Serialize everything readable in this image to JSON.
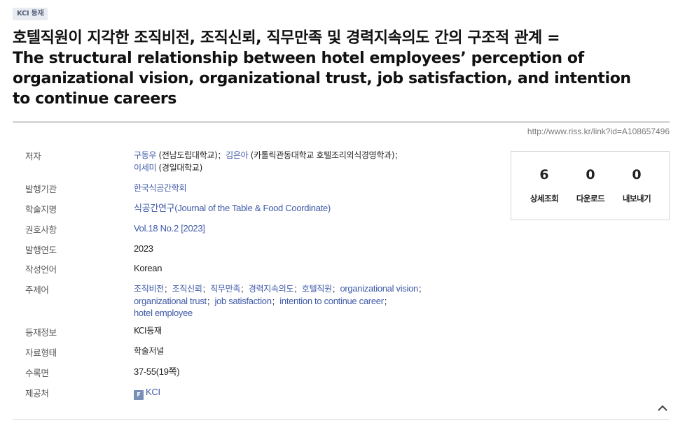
{
  "badge": "KCI 등재",
  "title": {
    "korean": "호텔직원이 지각한 조직비전, 조직신뢰, 직무만족 및 경력지속의도 간의 구조적 관계 =",
    "english": "The structural relationship between hotel employees’ perception of organizational vision, organizational trust, job satisfaction, and intention to continue careers"
  },
  "url": "http://www.riss.kr/link?id=A108657496",
  "fields": {
    "author": {
      "label": "저자",
      "authors": [
        {
          "name": "구동우",
          "affiliation": "(전남도립대학교)"
        },
        {
          "name": "김은아",
          "affiliation": "(카톨릭관동대학교 호텔조리외식경영학과)"
        },
        {
          "name": "이세미",
          "affiliation": "(경일대학교)"
        }
      ]
    },
    "publisher": {
      "label": "발행기관",
      "value": "한국식공간학회"
    },
    "journal": {
      "label": "학술지명",
      "value": "식공간연구(Journal of the Table & Food Coordinate)"
    },
    "volume": {
      "label": "권호사항",
      "value": "Vol.18 No.2 [2023]"
    },
    "year": {
      "label": "발행연도",
      "value": "2023"
    },
    "language": {
      "label": "작성언어",
      "value": "Korean"
    },
    "keywords": {
      "label": "주제어",
      "items": [
        "조직비전",
        "조직신뢰",
        "직무만족",
        "경력지속의도",
        "호텔직원",
        "organizational vision",
        "organizational trust",
        "job satisfaction",
        "intention to continue career",
        "hotel employee"
      ]
    },
    "registration": {
      "label": "등재정보",
      "value": "KCI등재"
    },
    "type": {
      "label": "자료형태",
      "value": "학술저널"
    },
    "pages": {
      "label": "수록면",
      "value": "37-55(19쪽)"
    },
    "provider": {
      "label": "제공처",
      "value": "KCI",
      "icon_letter": "F"
    }
  },
  "stats": [
    {
      "value": "6",
      "label": "상세조회"
    },
    {
      "value": "0",
      "label": "다운로드"
    },
    {
      "value": "0",
      "label": "내보내기"
    }
  ],
  "colors": {
    "link": "#3f5aa8",
    "badge_bg": "#e8ebf1",
    "icon_bg": "#7a8fb8"
  }
}
